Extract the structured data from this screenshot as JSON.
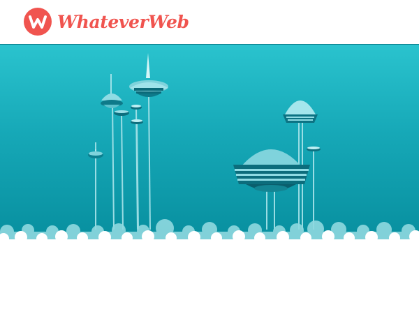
{
  "header": {
    "brand_name": "WhateverWeb",
    "logo_icon": "whateverweb-w-logo",
    "brand_color": "#f0544f"
  },
  "hero": {
    "illustration": "futuristic-sky-city",
    "sky_color_top": "#2ac3ce",
    "sky_color_bottom": "#078e9e",
    "cloud_color": "#ffffff"
  }
}
